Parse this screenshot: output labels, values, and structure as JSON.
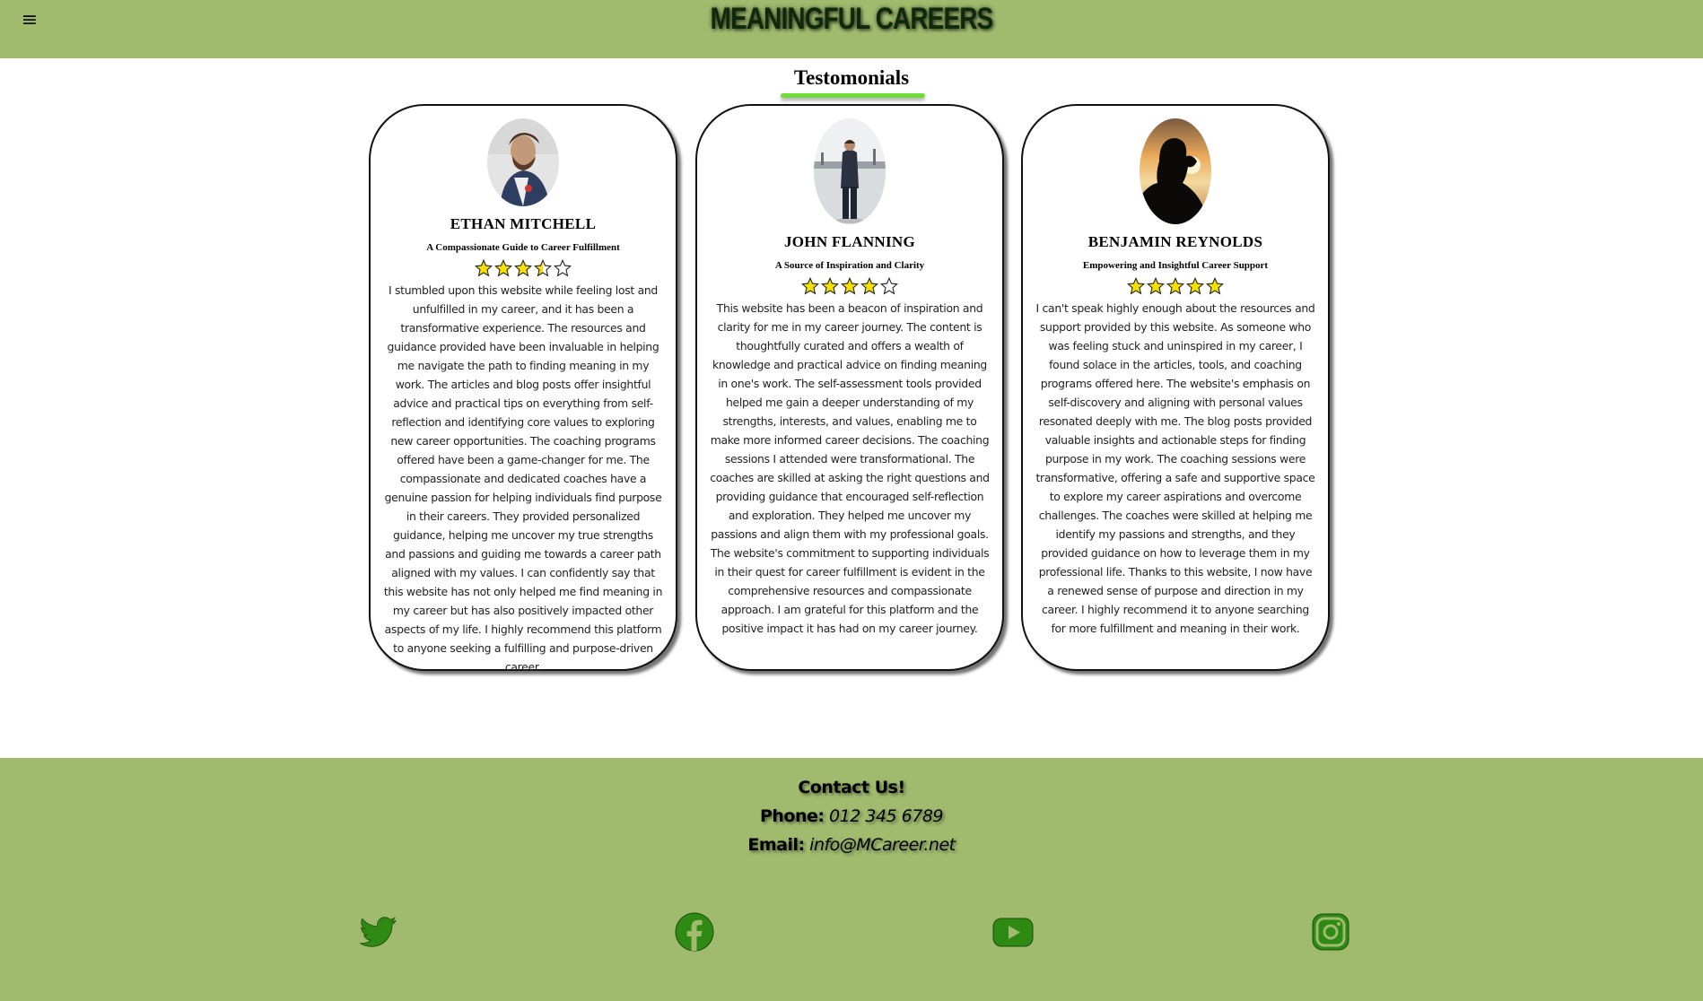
{
  "header": {
    "menu_icon": "≡",
    "title": "MEANINGFUL CAREERS"
  },
  "section": {
    "title": "Testomonials"
  },
  "testimonials": [
    {
      "name": "ETHAN MITCHELL",
      "tagline": "A Compassionate Guide to Career Fulfillment",
      "rating": 3.5,
      "review": "I stumbled upon this website while feeling lost and unfulfilled in my career, and it has been a transformative experience. The resources and guidance provided have been invaluable in helping me navigate the path to finding meaning in my work. The articles and blog posts offer insightful advice and practical tips on everything from self-reflection and identifying core values to exploring new career opportunities. The coaching programs offered have been a game-changer for me. The compassionate and dedicated coaches have a genuine passion for helping individuals find purpose in their careers. They provided personalized guidance, helping me uncover my true strengths and passions and guiding me towards a career path aligned with my values. I can confidently say that this website has not only helped me find meaning in my career but has also positively impacted other aspects of my life. I highly recommend this platform to anyone seeking a fulfilling and purpose-driven career."
    },
    {
      "name": "JOHN FLANNING",
      "tagline": "A Source of Inspiration and Clarity",
      "rating": 4,
      "review": "This website has been a beacon of inspiration and clarity for me in my career journey. The content is thoughtfully curated and offers a wealth of knowledge and practical advice on finding meaning in one's work. The self-assessment tools provided helped me gain a deeper understanding of my strengths, interests, and values, enabling me to make more informed career decisions. The coaching sessions I attended were transformational. The coaches are skilled at asking the right questions and providing guidance that encouraged self-reflection and exploration. They helped me uncover my passions and align them with my professional goals. The website's commitment to supporting individuals in their quest for career fulfillment is evident in the comprehensive resources and compassionate approach. I am grateful for this platform and the positive impact it has had on my career journey."
    },
    {
      "name": "BENJAMIN REYNOLDS",
      "tagline": "Empowering and Insightful Career Support",
      "rating": 5,
      "review": "I can't speak highly enough about the resources and support provided by this website. As someone who was feeling stuck and uninspired in my career, I found solace in the articles, tools, and coaching programs offered here. The website's emphasis on self-discovery and aligning with personal values resonated deeply with me. The blog posts provided valuable insights and actionable steps for finding purpose in my work. The coaching sessions were transformative, offering a safe and supportive space to explore my career aspirations and overcome challenges. The coaches were skilled at helping me identify my passions and strengths, and they provided guidance on how to leverage them in my professional life. Thanks to this website, I now have a renewed sense of purpose and direction in my career. I highly recommend it to anyone searching for more fulfillment and meaning in their work."
    }
  ],
  "footer": {
    "contact_heading": "Contact Us!",
    "phone_label": "Phone:",
    "phone_value": "012 345 6789",
    "email_label": "Email:",
    "email_value": "info@MCareer.net",
    "social": [
      "twitter-icon",
      "facebook-icon",
      "youtube-icon",
      "instagram-icon"
    ]
  },
  "colors": {
    "header_footer_bg": "#a0bb6e",
    "accent_underline": "#6fdc3a",
    "icon_green": "#2f8a14",
    "star_fill": "#f5e000"
  }
}
